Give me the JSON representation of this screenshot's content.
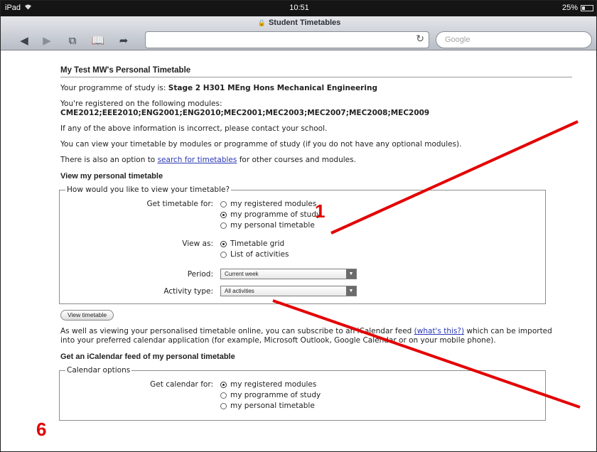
{
  "statusbar": {
    "device": "iPad",
    "time": "10:51",
    "battery_text": "25%",
    "battery_level": 0.25
  },
  "browser": {
    "tab_title": "Student Timetables",
    "search_placeholder": "Google",
    "icons": [
      "back-icon",
      "forward-icon",
      "tabs-icon",
      "bookmarks-icon",
      "share-icon",
      "reload-icon",
      "lock-icon",
      "wifi-icon",
      "battery-icon"
    ]
  },
  "page": {
    "title": "My Test MW's Personal Timetable",
    "programme_prefix": "Your programme of study is: ",
    "programme": "Stage 2 H301 MEng Hons Mechanical Engineering",
    "modules_intro": "You're registered on the following modules:",
    "modules": "CME2012;EEE2010;ENG2001;ENG2010;MEC2001;MEC2003;MEC2007;MEC2008;MEC2009",
    "incorrect_note": "If any of the above information is incorrect, please contact your school.",
    "view_note": "You can view your timetable by modules or programme of study (if you do not have any optional modules).",
    "search_prefix": "There is also an option to ",
    "search_link": "search for timetables",
    "search_suffix": " for other courses and modules.",
    "view_heading": "View my personal timetable",
    "view_legend": "How would you like to view your timetable?",
    "get_label": "Get timetable for:",
    "get_options": [
      "my registered modules",
      "my programme of study",
      "my personal timetable"
    ],
    "get_selected": 1,
    "view_as_label": "View as:",
    "view_as_options": [
      "Timetable grid",
      "List of activities"
    ],
    "view_as_selected": 0,
    "period_label": "Period:",
    "period_value": "Current week",
    "activity_label": "Activity type:",
    "activity_value": "All activities",
    "view_button": "View timetable",
    "ical_prefix": "As well as viewing your personalised timetable online, you can subscribe to an iCalendar feed ",
    "ical_link": "(what's this?)",
    "ical_suffix_a": " which can be imported",
    "ical_suffix_b": "into your preferred calendar application (for example, Microsoft Outlook, Google Calendar or on your mobile phone).",
    "ical_heading": "Get an iCalendar feed of my personal timetable",
    "cal_legend": "Calendar options",
    "cal_label": "Get calendar for:",
    "cal_options": [
      "my registered modules",
      "my programme of study",
      "my personal timetable"
    ],
    "cal_selected": 0
  },
  "annotations": {
    "label_1": "1",
    "label_6": "6",
    "color": "#e40000"
  }
}
